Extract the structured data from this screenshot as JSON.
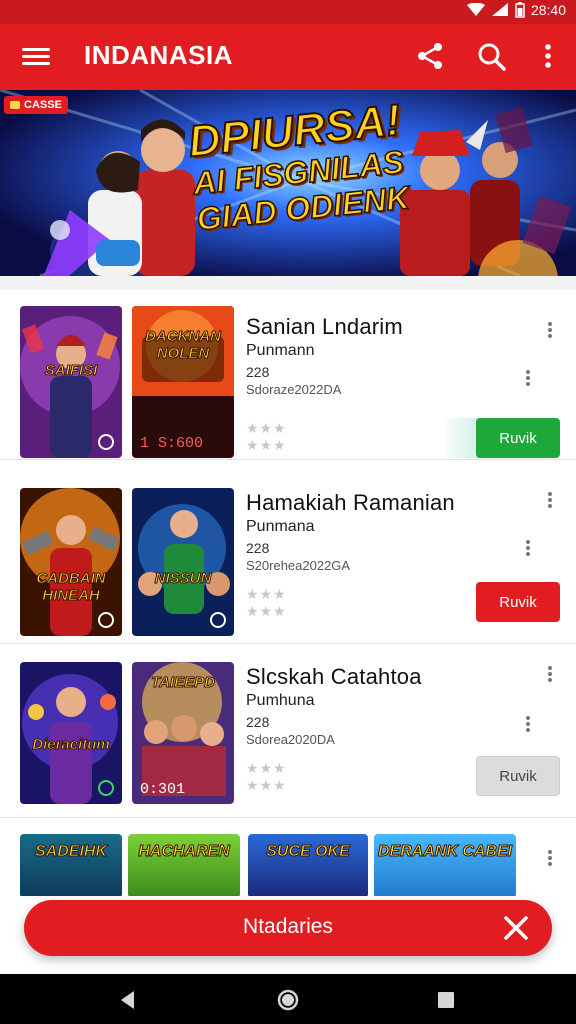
{
  "status_bar": {
    "time": "28:40"
  },
  "app_bar": {
    "title": "INDANASIA",
    "icons": [
      "menu-icon",
      "share-icon",
      "search-icon",
      "more-vert-icon"
    ]
  },
  "banner": {
    "badge": "CASSE",
    "headline_line1": "DPIURSA!",
    "headline_line2": "AI FISGNILAS",
    "headline_line3": "GIAD ODIENK"
  },
  "items": [
    {
      "name": "Sanian Lndarim",
      "subtitle": "Punmann",
      "number": "228",
      "date": "Sdoraze2022DA",
      "thumb1_label": "SAIFISI",
      "thumb2_label": "DACKNAN NOLEN",
      "thumb2_count": "1 S:600",
      "button_label": "Ruvik",
      "button_style": "green"
    },
    {
      "name": "Hamakiah Ramanian",
      "subtitle": "Punmana",
      "number": "228",
      "date": "S20rehea2022GA",
      "thumb1_label": "CADBAIN HINEAH",
      "thumb2_label": "NISSUN",
      "thumb2_count": "",
      "button_label": "Ruvik",
      "button_style": "red"
    },
    {
      "name": "Slcskah Catahtoa",
      "subtitle": "Pumhuna",
      "number": "228",
      "date": "Sdorea2020DA",
      "thumb1_label": "Dieracitum",
      "thumb2_label": "TAIEEPD",
      "thumb2_count": "0:301",
      "button_label": "Ruvik",
      "button_style": "gray"
    }
  ],
  "partial_row": {
    "labels": [
      "SADEIHK",
      "HACHAREN",
      "SUCE OKE",
      "DERAANK CABEI"
    ]
  },
  "bottom_bar": {
    "label": "Ntadaries"
  },
  "colors": {
    "brand": "#e11d21",
    "green": "#1ea83a",
    "gray": "#dcdcdc"
  }
}
